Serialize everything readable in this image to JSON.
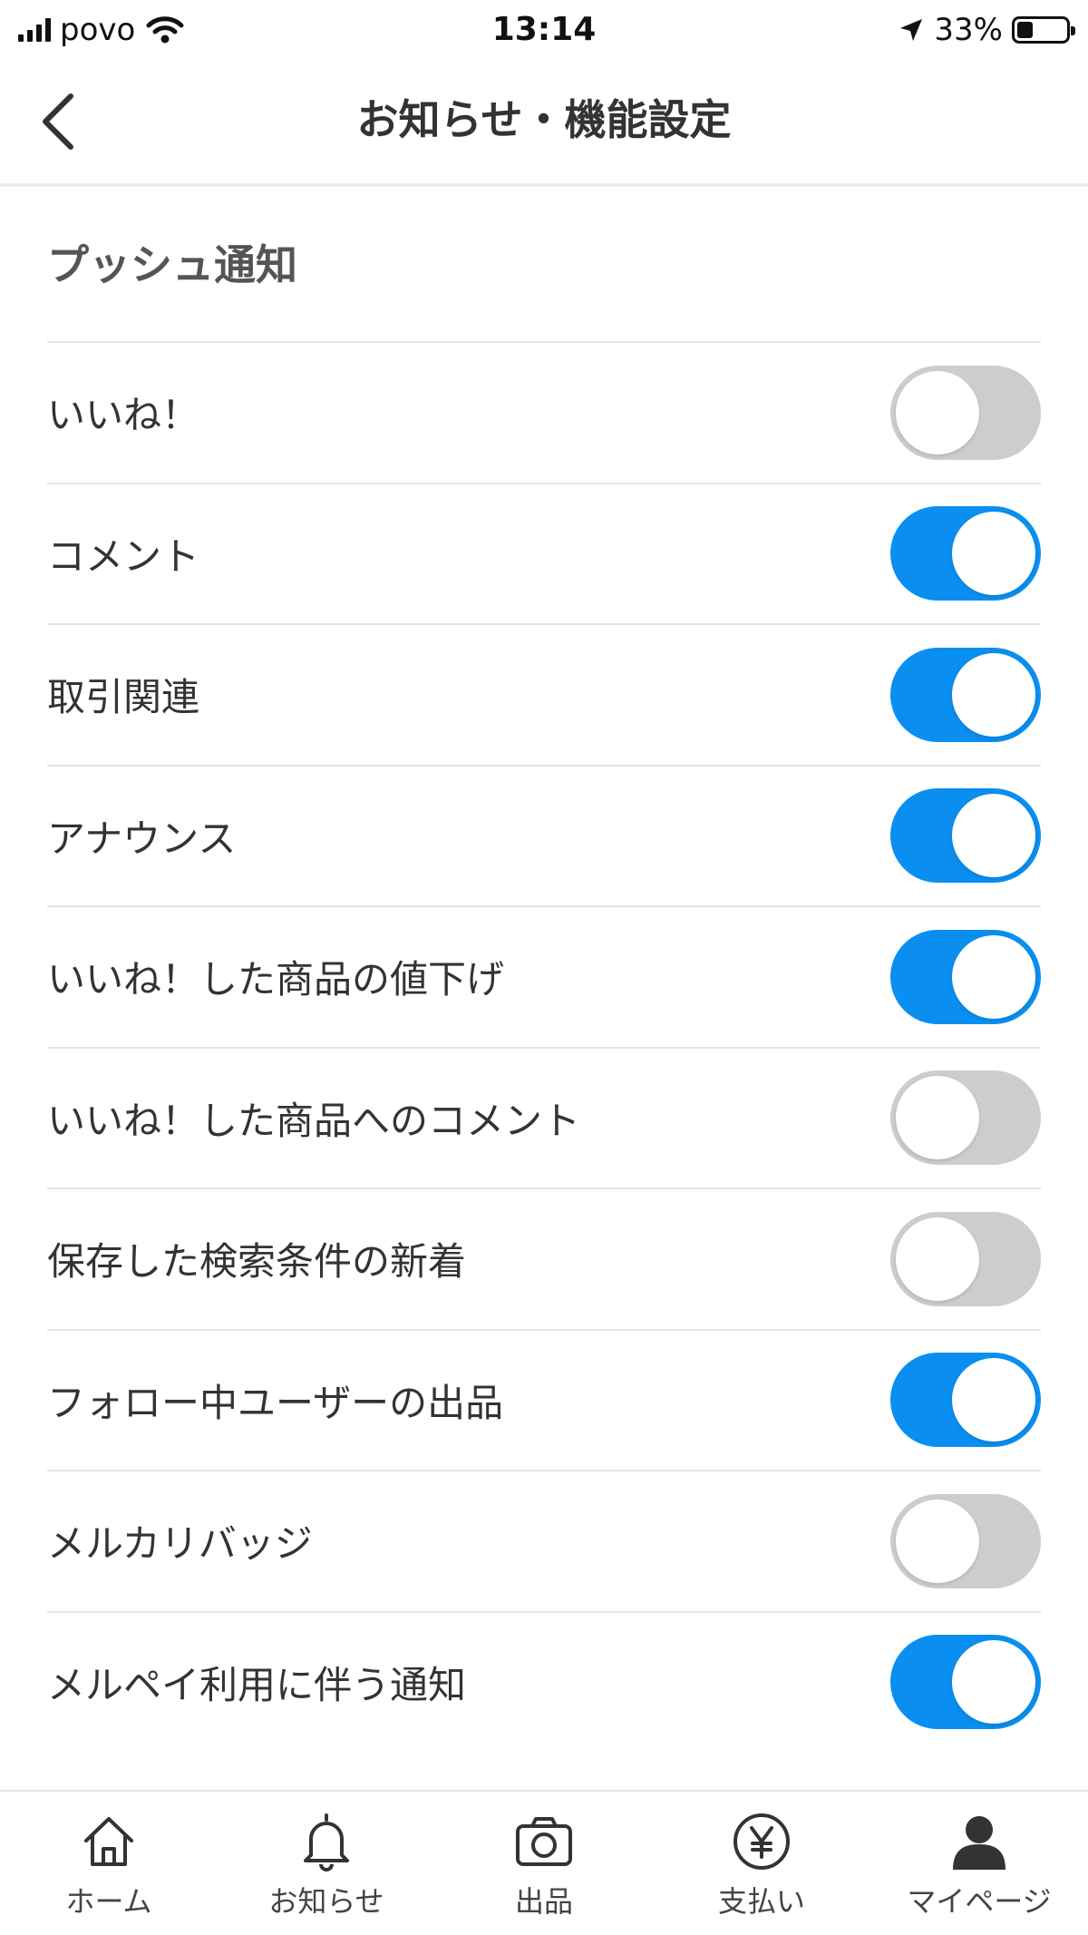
{
  "status_bar": {
    "carrier": "povo",
    "time": "13:14",
    "battery_percent": "33%",
    "battery_level": 0.33
  },
  "nav": {
    "title": "お知らせ・機能設定"
  },
  "section": {
    "title": "プッシュ通知"
  },
  "settings": [
    {
      "label": "いいね！",
      "on": false
    },
    {
      "label": "コメント",
      "on": true
    },
    {
      "label": "取引関連",
      "on": true
    },
    {
      "label": "アナウンス",
      "on": true
    },
    {
      "label": "いいね！した商品の値下げ",
      "on": true
    },
    {
      "label": "いいね！した商品へのコメント",
      "on": false
    },
    {
      "label": "保存した検索条件の新着",
      "on": false
    },
    {
      "label": "フォロー中ユーザーの出品",
      "on": true
    },
    {
      "label": "メルカリバッジ",
      "on": false
    },
    {
      "label": "メルペイ利用に伴う通知",
      "on": true
    }
  ],
  "tabs": [
    {
      "label": "ホーム",
      "icon": "home-icon"
    },
    {
      "label": "お知らせ",
      "icon": "bell-icon"
    },
    {
      "label": "出品",
      "icon": "camera-icon"
    },
    {
      "label": "支払い",
      "icon": "yen-icon"
    },
    {
      "label": "マイページ",
      "icon": "person-icon"
    }
  ],
  "colors": {
    "toggle_on": "#0a8ff0",
    "toggle_off": "#cdcdcd"
  }
}
